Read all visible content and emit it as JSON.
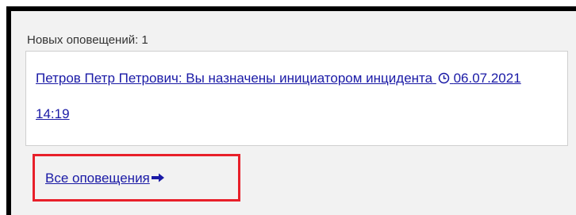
{
  "header": {
    "new_notifications_label": "Новых оповещений: 1"
  },
  "notifications": [
    {
      "text": "Петров Петр Петрович: Вы назначены инициатором инцидента",
      "icon": "clock-icon",
      "timestamp": "06.07.2021 14:19"
    }
  ],
  "footer": {
    "all_notifications_label": "Все оповещения",
    "arrow_icon": "arrow-right-icon"
  },
  "colors": {
    "link": "#1a1aa6",
    "highlight_border": "#e8202a",
    "panel_background": "#f2f2f2"
  }
}
